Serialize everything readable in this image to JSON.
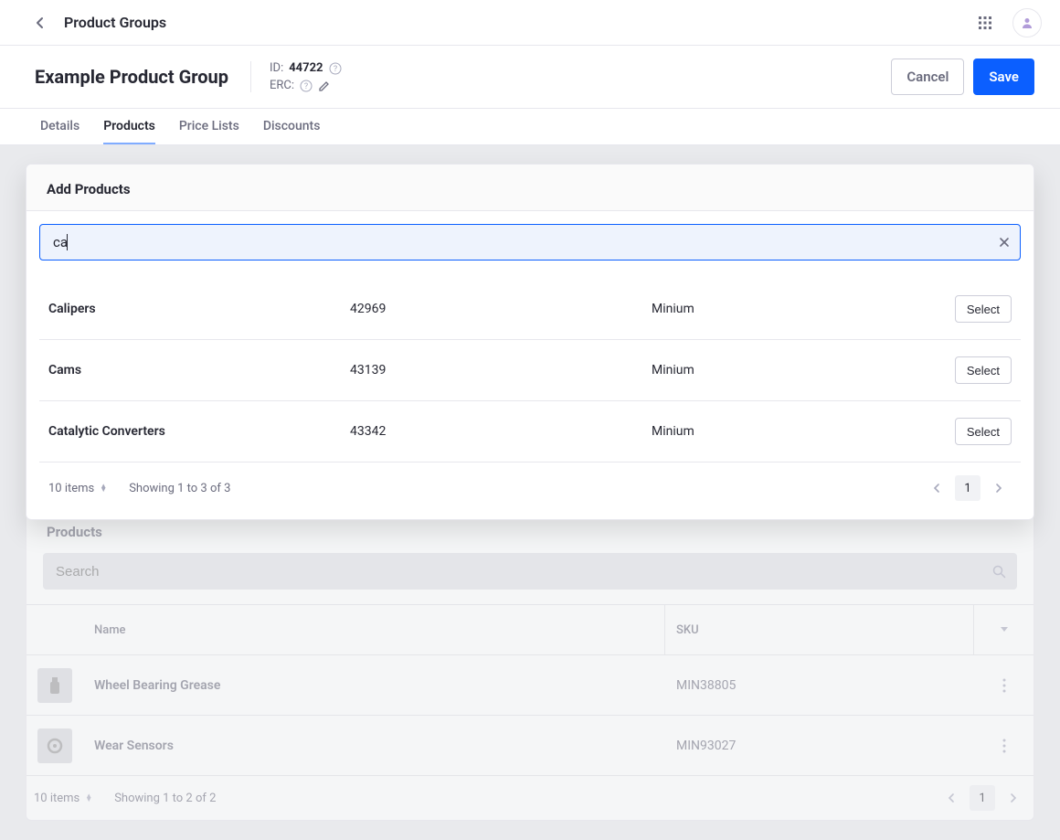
{
  "topbar": {
    "breadcrumb": "Product Groups"
  },
  "header": {
    "title": "Example Product Group",
    "id_label": "ID:",
    "id_value": "44722",
    "erc_label": "ERC:",
    "actions": {
      "cancel": "Cancel",
      "save": "Save"
    }
  },
  "tabs": [
    {
      "label": "Details",
      "active": false
    },
    {
      "label": "Products",
      "active": true
    },
    {
      "label": "Price Lists",
      "active": false
    },
    {
      "label": "Discounts",
      "active": false
    }
  ],
  "add_panel": {
    "title": "Add Products",
    "search_value": "ca",
    "results": [
      {
        "name": "Calipers",
        "id": "42969",
        "catalog": "Minium"
      },
      {
        "name": "Cams",
        "id": "43139",
        "catalog": "Minium"
      },
      {
        "name": "Catalytic Converters",
        "id": "43342",
        "catalog": "Minium"
      }
    ],
    "select_label": "Select",
    "footer": {
      "items_label": "10 items",
      "showing": "Showing 1 to 3 of 3",
      "page": "1"
    }
  },
  "products_panel": {
    "title": "Products",
    "search_placeholder": "Search",
    "columns": {
      "name": "Name",
      "sku": "SKU"
    },
    "rows": [
      {
        "name": "Wheel Bearing Grease",
        "sku": "MIN38805",
        "icon": "bottle"
      },
      {
        "name": "Wear Sensors",
        "sku": "MIN93027",
        "icon": "disc"
      }
    ],
    "footer": {
      "items_label": "10 items",
      "showing": "Showing 1 to 2 of 2",
      "page": "1"
    }
  }
}
